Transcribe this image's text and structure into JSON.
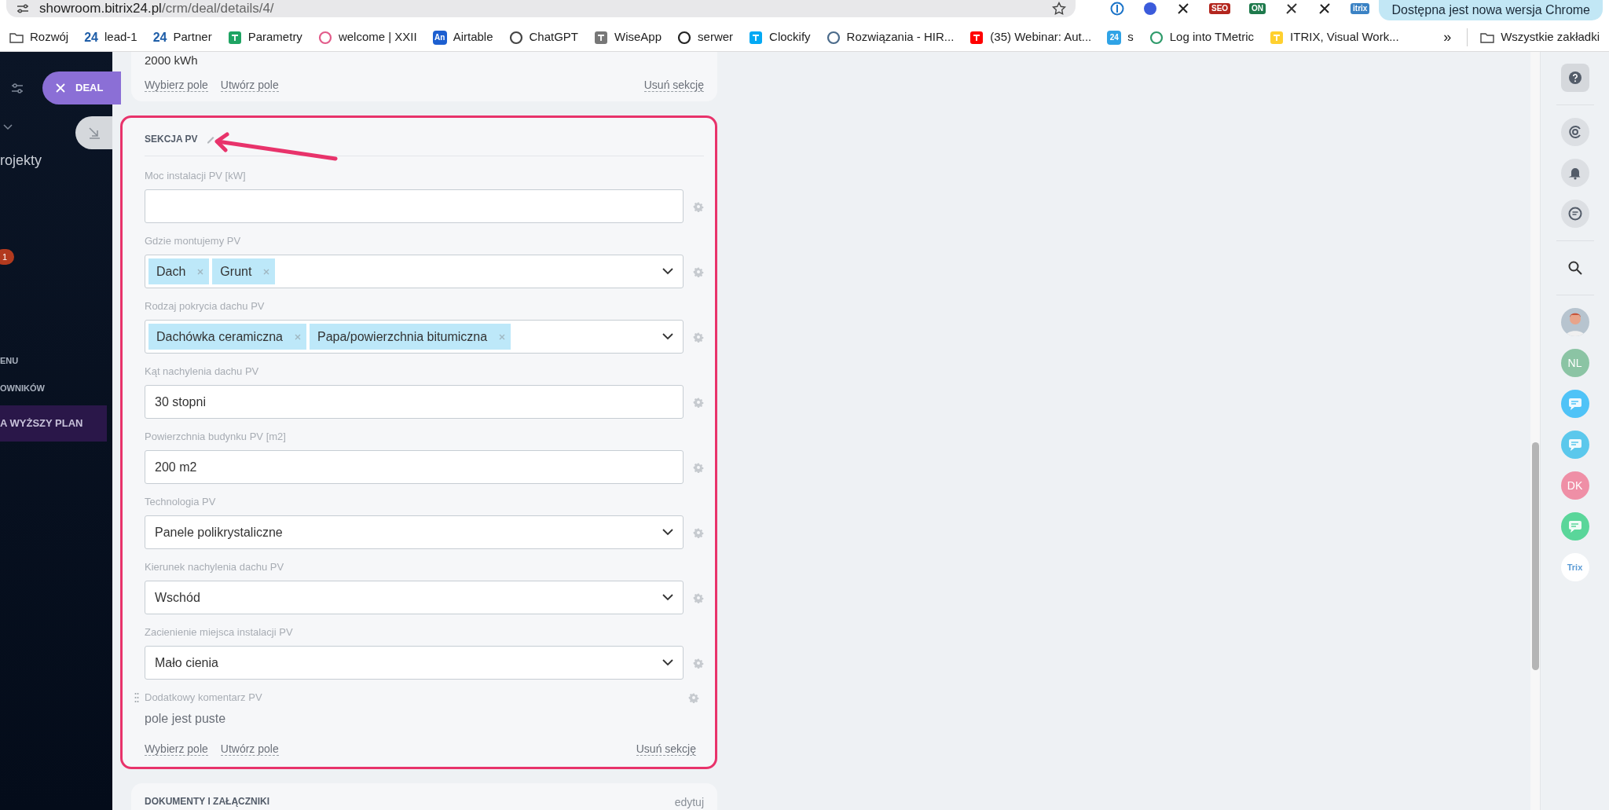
{
  "browser": {
    "url_host": "showroom.bitrix24.pl",
    "url_path": "/crm/deal/details/4/",
    "update_button": "Dostępna jest nowa wersja Chrome",
    "extensions": [
      {
        "kind": "ring",
        "color": "#1a73c8"
      },
      {
        "kind": "dot",
        "color": "#3b5bdb"
      },
      {
        "kind": "glyph",
        "color": "#222222"
      },
      {
        "kind": "badge",
        "badge": "SEO",
        "color": "#b3261e"
      },
      {
        "kind": "badge",
        "badge": "ON",
        "color": "#1e7a4c"
      },
      {
        "kind": "glyph",
        "color": "#333333"
      },
      {
        "kind": "glyph",
        "color": "#222222"
      },
      {
        "kind": "badge",
        "badge": "itrix",
        "color": "#3b82c4"
      }
    ],
    "bookmarks": [
      {
        "label": "Rozwój",
        "kind": "folder"
      },
      {
        "label": "lead-1",
        "kind": "text",
        "badge": "24",
        "color": "#1f5ea8"
      },
      {
        "label": "Partner",
        "kind": "text",
        "badge": "24",
        "color": "#1f5ea8"
      },
      {
        "label": "Parametry",
        "kind": "square",
        "color": "#1fa463"
      },
      {
        "label": "welcome | XXII",
        "kind": "dot",
        "color": "#e25b8a"
      },
      {
        "label": "Airtable",
        "kind": "badge",
        "badge": "An",
        "color": "#1d5fd0"
      },
      {
        "label": "ChatGPT",
        "kind": "dot",
        "color": "#444444"
      },
      {
        "label": "WiseApp",
        "kind": "square",
        "color": "#777777"
      },
      {
        "label": "serwer",
        "kind": "dot",
        "color": "#222222"
      },
      {
        "label": "Clockify",
        "kind": "square",
        "color": "#03a9f4"
      },
      {
        "label": "Rozwiązania - HIR...",
        "kind": "dot",
        "color": "#4a6a8a"
      },
      {
        "label": "(35) Webinar: Aut...",
        "kind": "square",
        "color": "#ff0000"
      },
      {
        "label": "s",
        "kind": "badge",
        "badge": "24",
        "color": "#2fa3e6"
      },
      {
        "label": "Log into TMetric",
        "kind": "dot",
        "color": "#2e9a6a"
      },
      {
        "label": "ITRIX, Visual Work...",
        "kind": "square",
        "color": "#ffd02f"
      }
    ],
    "bookmarks_more": "»",
    "all_bookmarks": "Wszystkie zakładki"
  },
  "sidebar": {
    "deal_button": "DEAL",
    "items": [
      {
        "kind": "text",
        "label": "rojekty"
      },
      {
        "kind": "counter",
        "label": "1"
      },
      {
        "kind": "caps",
        "label": "ENU"
      },
      {
        "kind": "caps",
        "label": "OWNIKÓW"
      },
      {
        "kind": "plan",
        "label": "A WYŻSZY PLAN"
      }
    ]
  },
  "previous_section": {
    "value": "2000 kWh",
    "links": [
      "Wybierz pole",
      "Utwórz pole"
    ],
    "delete_link": "Usuń sekcję"
  },
  "section": {
    "title": "SEKCJA PV",
    "highlighted": true,
    "fields": [
      {
        "kind": "text",
        "label": "Moc instalacji PV [kW]"
      },
      {
        "kind": "multiselect",
        "label": "Gdzie montujemy PV",
        "tags": [
          "Dach",
          "Grunt"
        ]
      },
      {
        "kind": "multiselect",
        "label": "Rodzaj pokrycia dachu PV",
        "tags": [
          "Dachówka ceramiczna",
          "Papa/powierzchnia bitumiczna"
        ]
      },
      {
        "kind": "text",
        "label": "Kąt nachylenia dachu PV",
        "value": "30 stopni"
      },
      {
        "kind": "text",
        "label": "Powierzchnia budynku PV [m2]",
        "value": "200 m2"
      },
      {
        "kind": "select",
        "label": "Technologia PV",
        "value": "Panele polikrystaliczne"
      },
      {
        "kind": "select",
        "label": "Kierunek nachylenia dachu PV",
        "value": "Wschód"
      },
      {
        "kind": "select",
        "label": "Zacienienie miejsca instalacji PV",
        "value": "Mało cienia"
      },
      {
        "kind": "comment",
        "label": "Dodatkowy komentarz PV",
        "value": "pole jest puste"
      }
    ],
    "links": [
      "Wybierz pole",
      "Utwórz pole"
    ],
    "delete_link": "Usuń sekcję"
  },
  "documents": {
    "title": "DOKUMENTY I ZAŁĄCZNIKI",
    "edit_link": "edytuj"
  },
  "right_rail": [
    {
      "kind": "help"
    },
    {
      "kind": "divider"
    },
    {
      "kind": "copilot"
    },
    {
      "kind": "bell"
    },
    {
      "kind": "chat"
    },
    {
      "kind": "divider"
    },
    {
      "kind": "search"
    },
    {
      "kind": "divider"
    },
    {
      "kind": "photo"
    },
    {
      "kind": "initials",
      "initials": "NL",
      "color": "#8bc4a4"
    },
    {
      "kind": "app",
      "color": "#4fc3f7"
    },
    {
      "kind": "app",
      "color": "#5bc8ec"
    },
    {
      "kind": "initials",
      "initials": "DK",
      "color": "#ef8fa6"
    },
    {
      "kind": "app",
      "color": "#5ad69a"
    },
    {
      "kind": "logo",
      "initials": "Trix"
    }
  ]
}
